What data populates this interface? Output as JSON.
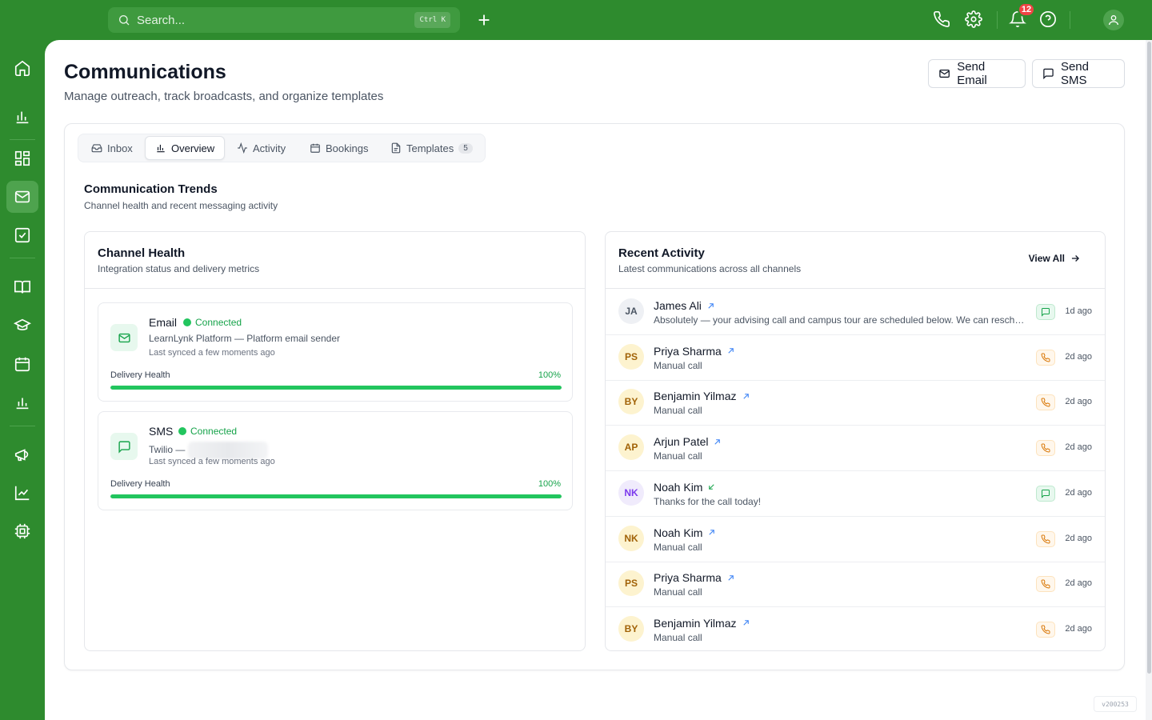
{
  "topbar": {
    "search_placeholder": "Search...",
    "search_shortcut": "Ctrl K",
    "notifications_count": "12"
  },
  "header": {
    "title": "Communications",
    "subtitle": "Manage outreach, track broadcasts, and organize templates",
    "send_email_label": "Send Email",
    "send_sms_label": "Send SMS"
  },
  "tabs": [
    {
      "label": "Inbox",
      "icon": "inbox-icon"
    },
    {
      "label": "Overview",
      "icon": "bar-chart-icon",
      "active": true
    },
    {
      "label": "Activity",
      "icon": "activity-icon"
    },
    {
      "label": "Bookings",
      "icon": "calendar-icon"
    },
    {
      "label": "Templates",
      "icon": "file-icon",
      "count": "5"
    }
  ],
  "trends": {
    "title": "Communication Trends",
    "subtitle": "Channel health and recent messaging activity"
  },
  "channel_health": {
    "title": "Channel Health",
    "subtitle": "Integration status and delivery metrics",
    "channels": [
      {
        "name": "Email",
        "status": "Connected",
        "description": "LearnLynk Platform — Platform email sender",
        "synced": "Last synced a few moments ago",
        "health_label": "Delivery Health",
        "health_value": "100%",
        "health_percent": 100
      },
      {
        "name": "SMS",
        "status": "Connected",
        "description": "Twilio —",
        "synced": "Last synced a few moments ago",
        "health_label": "Delivery Health",
        "health_value": "100%",
        "health_percent": 100
      }
    ]
  },
  "recent_activity": {
    "title": "Recent Activity",
    "subtitle": "Latest communications across all channels",
    "view_all_label": "View All",
    "items": [
      {
        "initials": "JA",
        "name": "James Ali",
        "direction": "outbound",
        "text": "Absolutely — your advising call and campus tour are scheduled below. We can reschedule anytime if needed.",
        "channel": "sms",
        "time": "1d ago",
        "avatar_bg": "#eef0f4",
        "avatar_fg": "#4b5563"
      },
      {
        "initials": "PS",
        "name": "Priya Sharma",
        "direction": "outbound",
        "text": "Manual call",
        "channel": "call",
        "time": "2d ago",
        "avatar_bg": "#fdf3cf",
        "avatar_fg": "#a16207"
      },
      {
        "initials": "BY",
        "name": "Benjamin Yilmaz",
        "direction": "outbound",
        "text": "Manual call",
        "channel": "call",
        "time": "2d ago",
        "avatar_bg": "#fdf3cf",
        "avatar_fg": "#a16207"
      },
      {
        "initials": "AP",
        "name": "Arjun Patel",
        "direction": "outbound",
        "text": "Manual call",
        "channel": "call",
        "time": "2d ago",
        "avatar_bg": "#fdf3cf",
        "avatar_fg": "#a16207"
      },
      {
        "initials": "NK",
        "name": "Noah Kim",
        "direction": "inbound",
        "text": "Thanks for the call today!",
        "channel": "sms",
        "time": "2d ago",
        "avatar_bg": "#f0ebfc",
        "avatar_fg": "#7c3aed"
      },
      {
        "initials": "NK",
        "name": "Noah Kim",
        "direction": "outbound",
        "text": "Manual call",
        "channel": "call",
        "time": "2d ago",
        "avatar_bg": "#fdf3cf",
        "avatar_fg": "#a16207"
      },
      {
        "initials": "PS",
        "name": "Priya Sharma",
        "direction": "outbound",
        "text": "Manual call",
        "channel": "call",
        "time": "2d ago",
        "avatar_bg": "#fdf3cf",
        "avatar_fg": "#a16207"
      },
      {
        "initials": "BY",
        "name": "Benjamin Yilmaz",
        "direction": "outbound",
        "text": "Manual call",
        "channel": "call",
        "time": "2d ago",
        "avatar_bg": "#fdf3cf",
        "avatar_fg": "#a16207"
      }
    ]
  },
  "version": "v200253",
  "colors": {
    "brand": "#2e8b2e",
    "success": "#22c55e",
    "badge": "#ef4444"
  }
}
